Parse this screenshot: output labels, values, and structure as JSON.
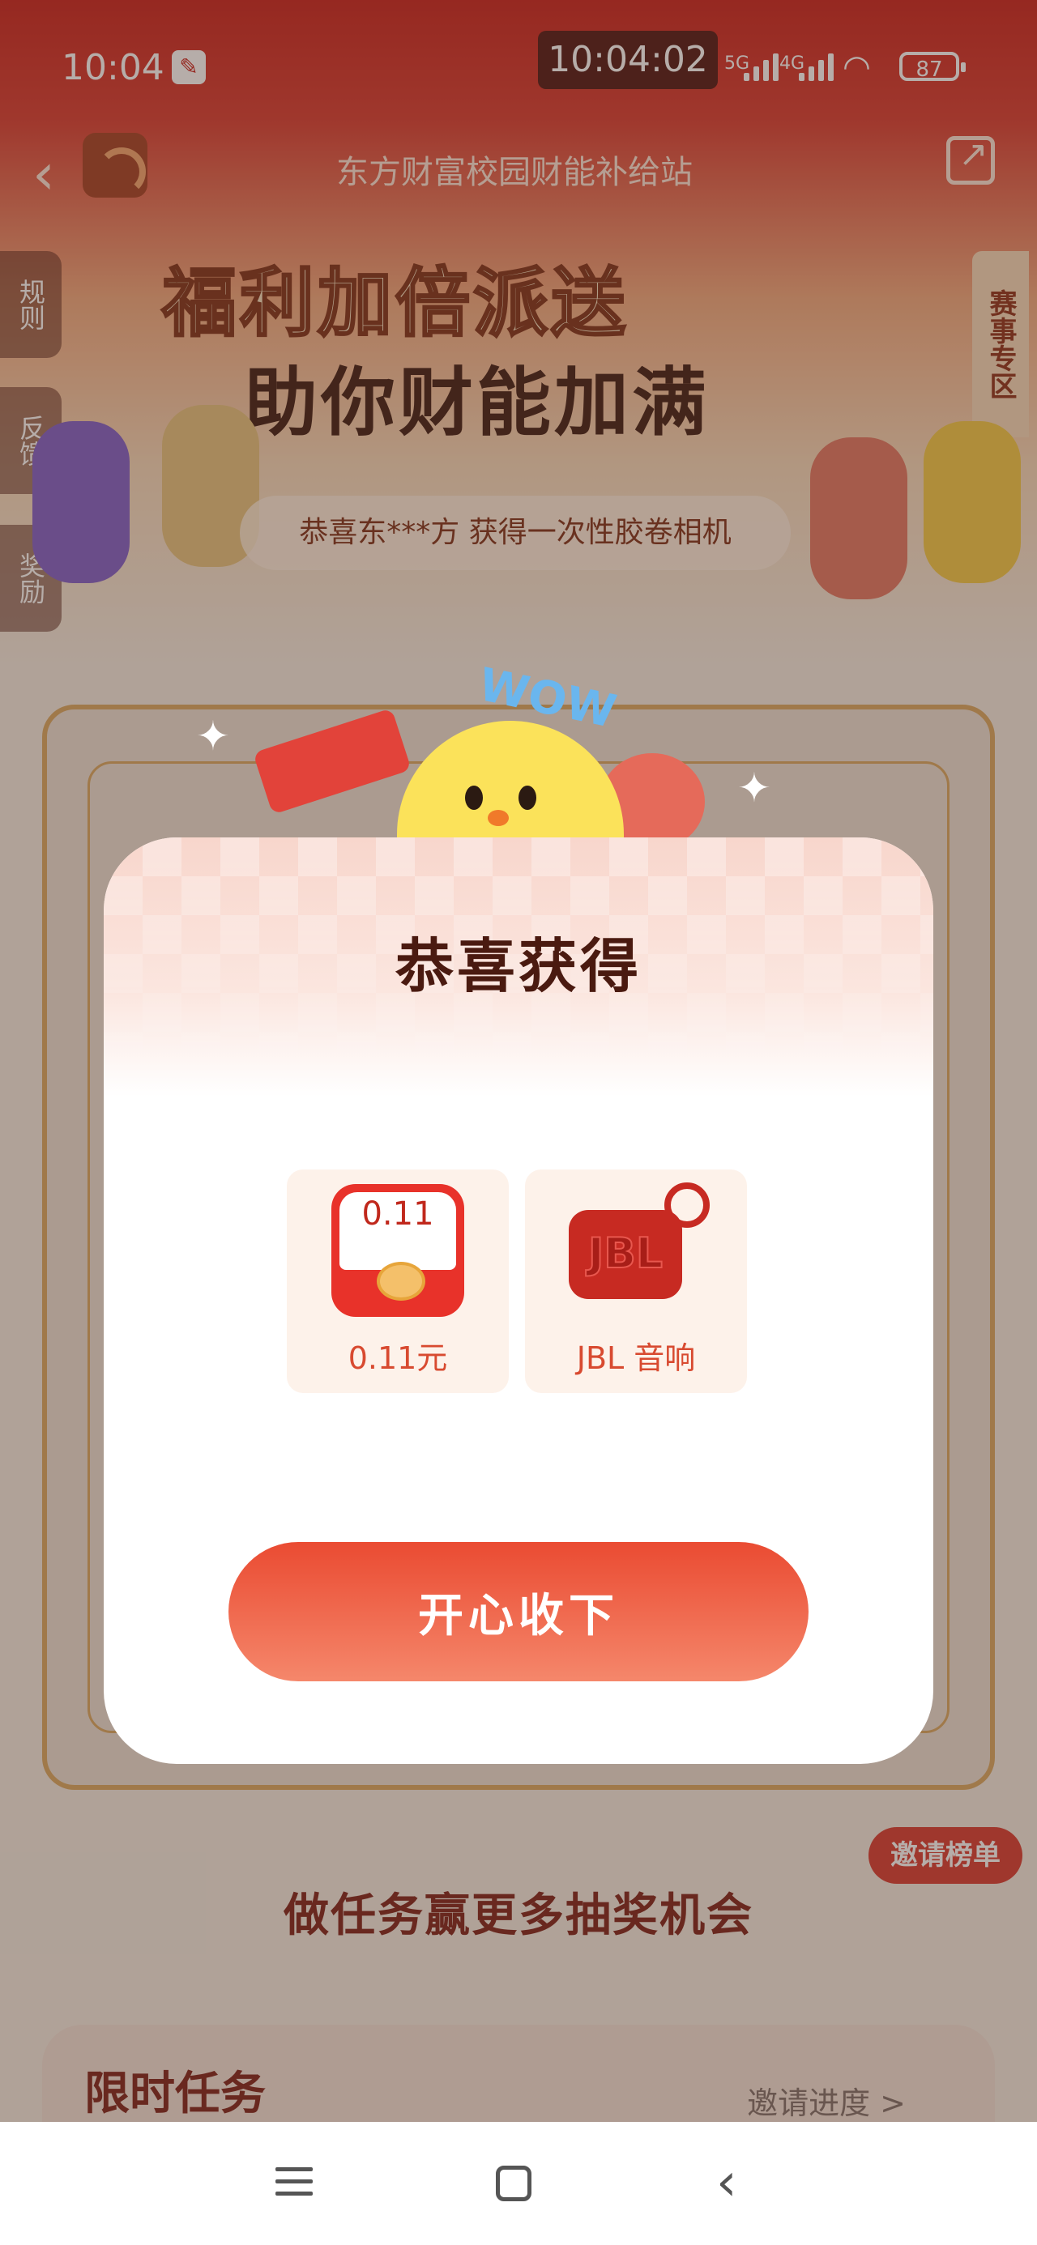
{
  "status_bar": {
    "time": "10:04",
    "clock_overlay": "10:04:02",
    "signal1": "5G",
    "signal2": "4G",
    "battery": "87"
  },
  "nav": {
    "title": "东方财富校园财能补给站"
  },
  "side_tabs": [
    "规则",
    "反馈",
    "奖励"
  ],
  "right_tab": "赛事专区",
  "banner": {
    "line1": "福利加倍派送",
    "line2": "助你财能加满"
  },
  "ticker": "恭喜东***方 获得一次性胶卷相机",
  "wow": "WOW",
  "modal": {
    "title": "恭喜获得",
    "prizes": [
      {
        "icon_text": "0.11",
        "label": "0.11元",
        "icon": "red-envelope-icon"
      },
      {
        "icon_text": "JBL",
        "label": "JBL 音响",
        "icon": "speaker-icon"
      }
    ],
    "accept_label": "开心收下"
  },
  "invite_rank": "邀请榜单",
  "task_section_title": "做任务赢更多抽奖机会",
  "limited_task": {
    "title": "限时任务",
    "progress_link": "邀请进度 >"
  },
  "colors": {
    "accent": "#e8322a",
    "title_dark": "#4a1a10",
    "button_start": "#ea4b32",
    "button_end": "#f5876b"
  }
}
